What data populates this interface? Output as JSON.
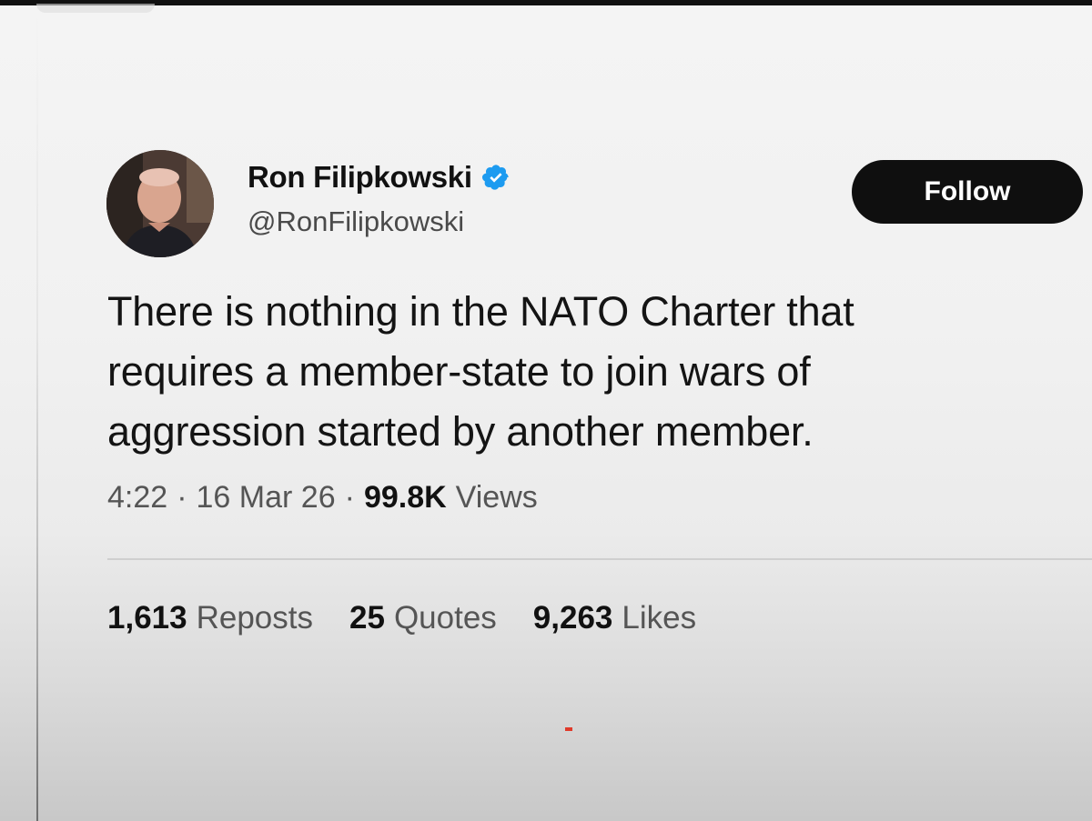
{
  "tweet": {
    "author": {
      "display_name": "Ron Filipkowski",
      "handle": "@RonFilipkowski",
      "verified": true
    },
    "follow_label": "Follow",
    "text": "There is nothing in the NATO Charter that\nrequires a member-state to join wars of\naggression started by another member.",
    "time": "4:22",
    "separator": "·",
    "date": "16 Mar 26",
    "views_count": "99.8K",
    "views_label": "Views",
    "stats": {
      "reposts_count": "1,613",
      "reposts_label": "Reposts",
      "quotes_count": "25",
      "quotes_label": "Quotes",
      "likes_count": "9,263",
      "likes_label": "Likes"
    }
  },
  "colors": {
    "verified_badge": "#1d9bf0",
    "follow_button_bg": "#0f0f0f",
    "text_primary": "#141414",
    "text_secondary": "#555555"
  },
  "icons": {
    "verified": "verified-badge-icon"
  }
}
